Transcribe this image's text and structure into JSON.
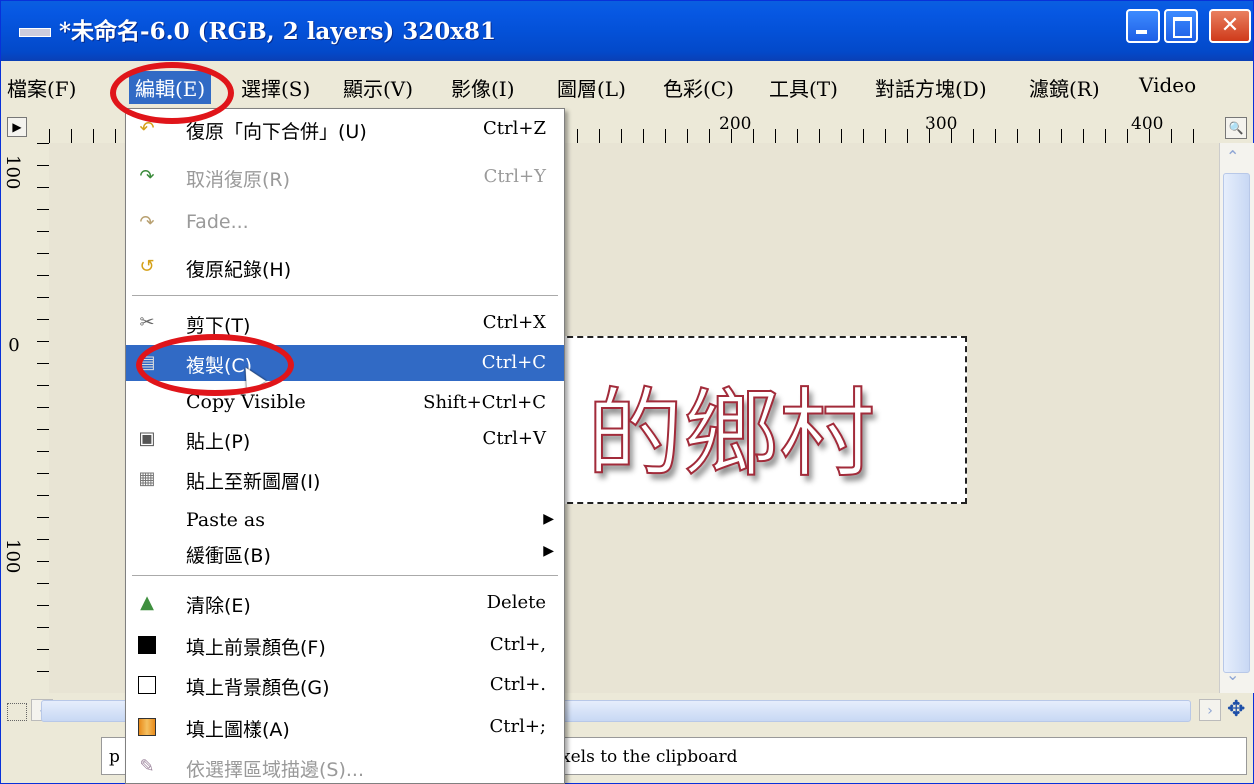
{
  "window": {
    "title": "*未命名-6.0 (RGB, 2 layers) 320x81",
    "controls": {
      "minimize": "minimize",
      "maximize": "maximize",
      "close": "✕"
    }
  },
  "menubar": [
    {
      "label": "檔案(F)"
    },
    {
      "label": "編輯(E)",
      "active": true
    },
    {
      "label": "選擇(S)"
    },
    {
      "label": "顯示(V)"
    },
    {
      "label": "影像(I)"
    },
    {
      "label": "圖層(L)"
    },
    {
      "label": "色彩(C)"
    },
    {
      "label": "工具(T)"
    },
    {
      "label": "對話方塊(D)"
    },
    {
      "label": "濾鏡(R)"
    },
    {
      "label": "Video"
    }
  ],
  "ruler_top": {
    "labels": [
      "200",
      "300",
      "400"
    ]
  },
  "ruler_left": {
    "labels": [
      "100",
      "0",
      "100"
    ]
  },
  "canvas": {
    "text": "的鄉村"
  },
  "edit_menu": {
    "items": [
      {
        "label": "復原「向下合併」(U)",
        "shortcut": "Ctrl+Z",
        "icon": "undo-icon"
      },
      {
        "label": "取消復原(R)",
        "shortcut": "Ctrl+Y",
        "icon": "redo-icon",
        "disabled": true
      },
      {
        "label": "Fade...",
        "shortcut": "",
        "icon": "fade-icon",
        "disabled": true
      },
      {
        "label": "復原紀錄(H)",
        "shortcut": "",
        "icon": "undo-history-icon"
      },
      {
        "separator": true
      },
      {
        "label": "剪下(T)",
        "shortcut": "Ctrl+X",
        "icon": "cut-icon"
      },
      {
        "label": "複製(C)",
        "shortcut": "Ctrl+C",
        "icon": "copy-icon",
        "highlighted": true
      },
      {
        "label": "Copy Visible",
        "shortcut": "Shift+Ctrl+C",
        "icon": ""
      },
      {
        "label": "貼上(P)",
        "shortcut": "Ctrl+V",
        "icon": "paste-icon"
      },
      {
        "label": "貼上至新圖層(I)",
        "shortcut": "",
        "icon": "paste-layer-icon"
      },
      {
        "label": "Paste as",
        "shortcut": "",
        "icon": "",
        "submenu": true
      },
      {
        "label": "緩衝區(B)",
        "shortcut": "",
        "icon": "",
        "submenu": true
      },
      {
        "separator": true
      },
      {
        "label": "清除(E)",
        "shortcut": "Delete",
        "icon": "clear-icon"
      },
      {
        "label": "填上前景顏色(F)",
        "shortcut": "Ctrl+,",
        "icon": "fg-color-icon"
      },
      {
        "label": "填上背景顏色(G)",
        "shortcut": "Ctrl+.",
        "icon": "bg-color-icon"
      },
      {
        "label": "填上圖樣(A)",
        "shortcut": "Ctrl+;",
        "icon": "pattern-icon"
      },
      {
        "label": "依選擇區域描邊(S)...",
        "shortcut": "",
        "icon": "stroke-icon",
        "disabled": true
      }
    ]
  },
  "statusbar": {
    "unit_fragment": "p",
    "message": "xels to the clipboard"
  },
  "colors": {
    "titlebar": "#0451d8",
    "highlight": "#316ac5",
    "annotation": "#e0151a",
    "canvas_bg": "#e8e4d4"
  }
}
